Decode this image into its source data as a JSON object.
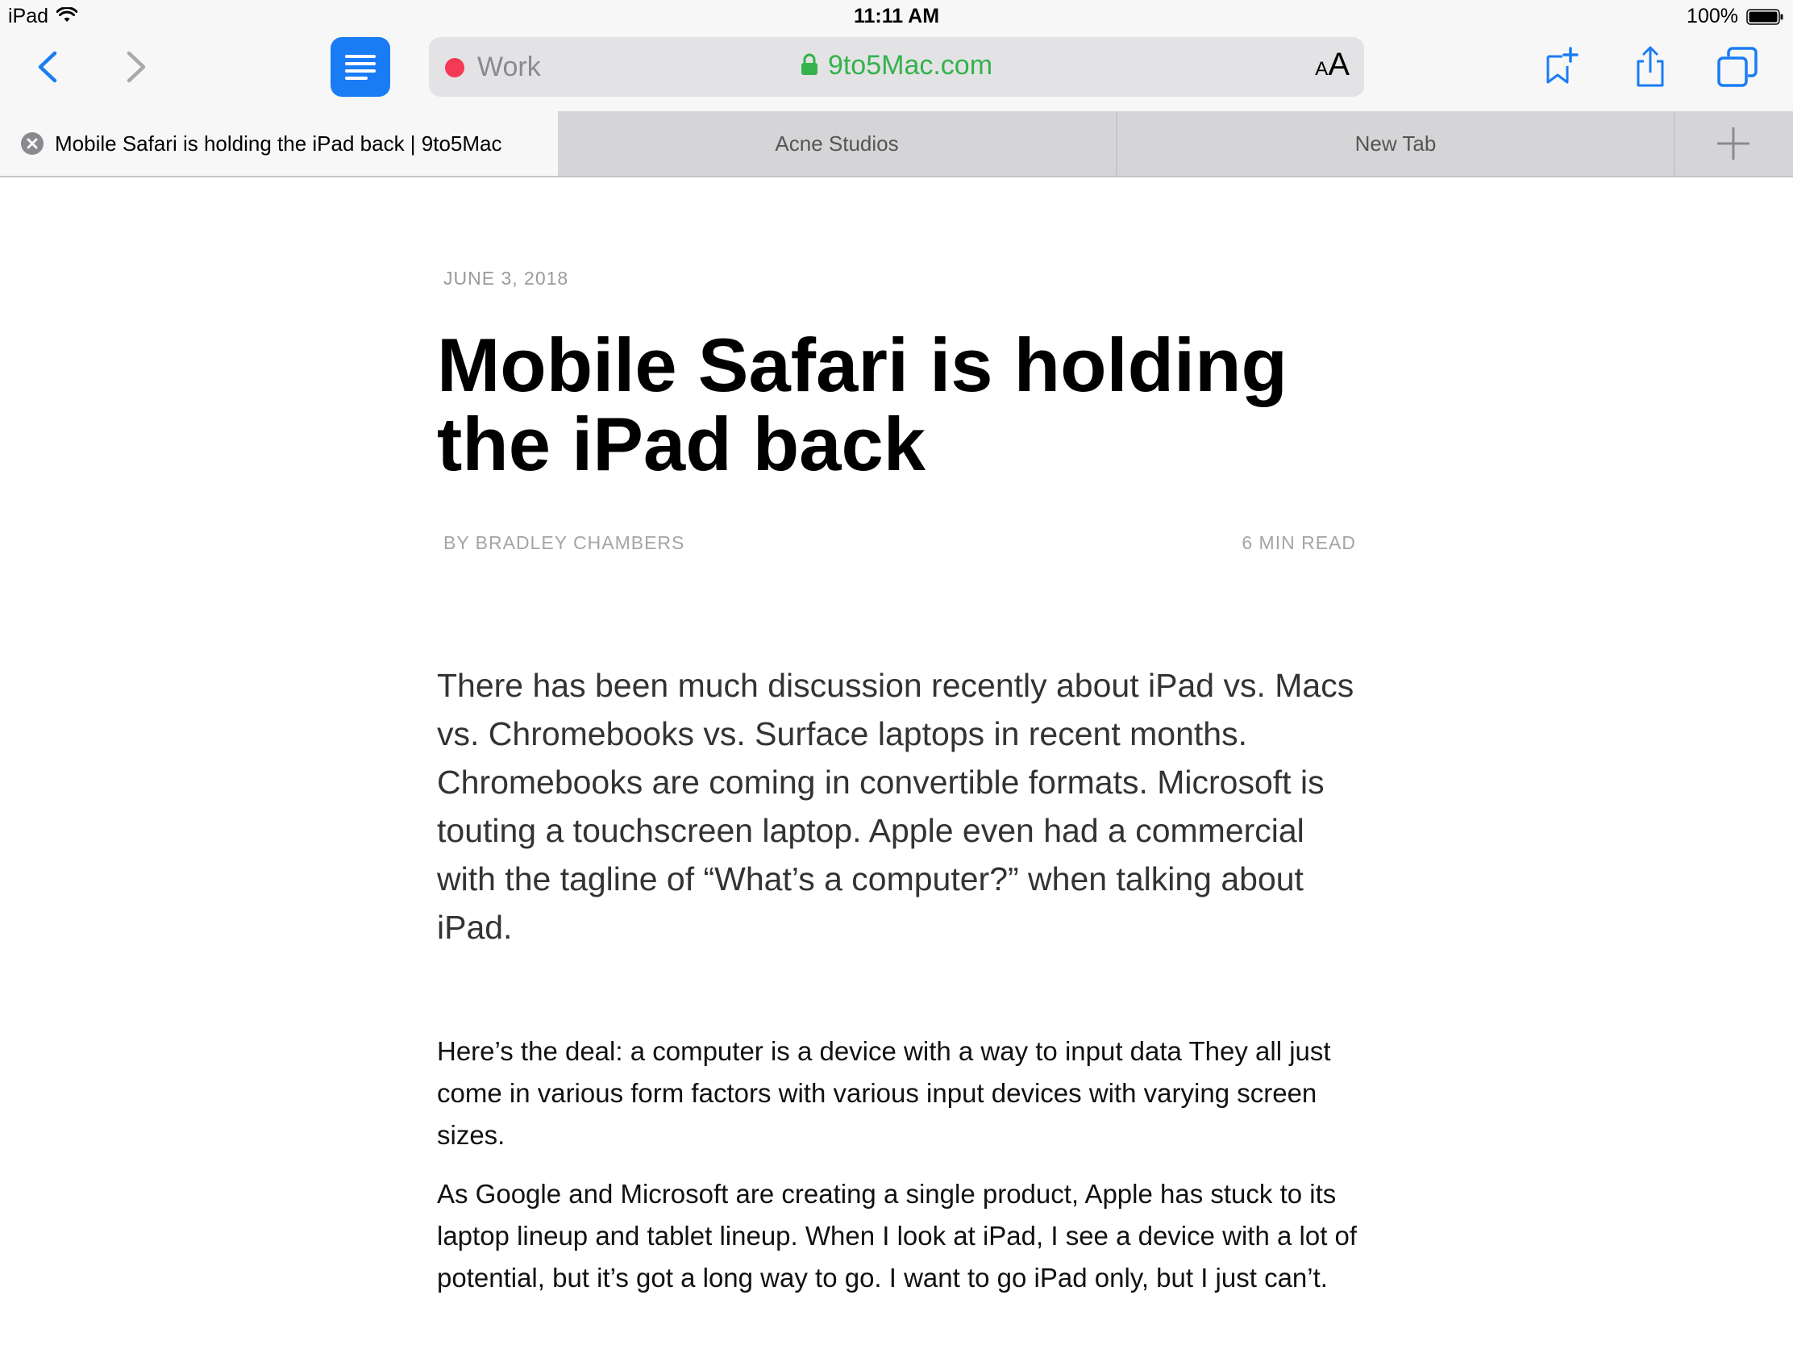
{
  "status_bar": {
    "device": "iPad",
    "time": "11:11 AM",
    "battery": "100%"
  },
  "toolbar": {
    "tab_group": "Work",
    "url": "9to5Mac.com",
    "text_size_small": "A",
    "text_size_large": "A",
    "accent_color": "#1a7cf5",
    "secure_color": "#34b24b",
    "group_dot_color": "#f43955"
  },
  "tabs": [
    {
      "label": "Mobile Safari is holding the iPad back | 9to5Mac",
      "active": true
    },
    {
      "label": "Acne Studios",
      "active": false
    },
    {
      "label": "New Tab",
      "active": false
    }
  ],
  "article": {
    "date": "JUNE 3, 2018",
    "title": "Mobile Safari is holding the iPad back",
    "byline": "BY BRADLEY CHAMBERS",
    "read_time": "6 MIN READ",
    "lead": "There has been much discussion recently about iPad vs. Macs vs. Chromebooks vs. Surface laptops in recent months. Chromebooks are coming in convertible formats. Microsoft is touting a touchscreen laptop. Apple even had a commercial with the tagline of “What’s a computer?” when talking about iPad.",
    "paragraphs": [
      "Here’s the deal: a computer is a device with a way to input data They all just come in various form factors with various input devices with varying screen sizes.",
      "As Google and Microsoft are creating a single product, Apple has stuck to its laptop lineup and tablet lineup. When I look at iPad, I see a device with a lot of potential, but it’s got a long way to go. I want to go iPad only, but I just can’t."
    ]
  },
  "icons": {
    "back": "chevron-left-icon",
    "forward": "chevron-right-icon",
    "reader": "reader-view-icon",
    "lock": "lock-icon",
    "bookmark_add": "add-bookmark-icon",
    "share": "share-icon",
    "tabs": "tabs-overview-icon",
    "new_tab": "plus-icon",
    "close_tab": "close-icon"
  }
}
